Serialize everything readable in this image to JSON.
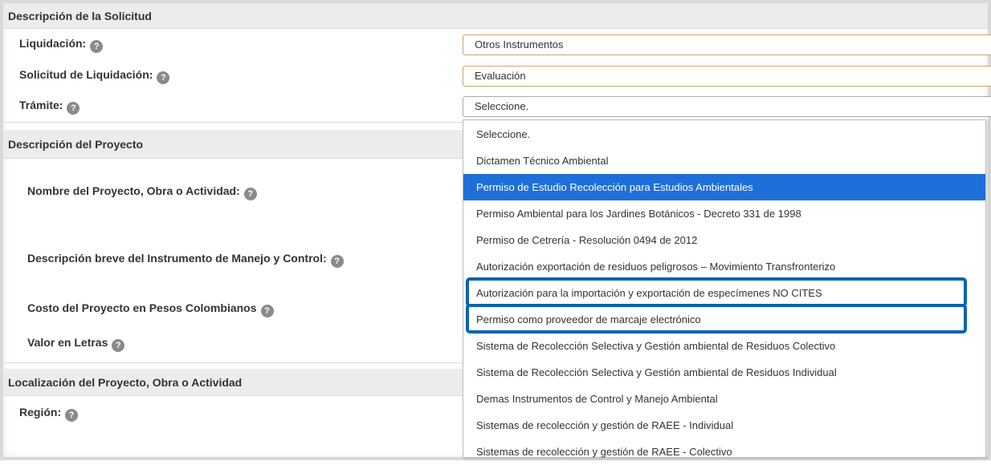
{
  "sections": {
    "solicitud": "Descripción de la Solicitud",
    "proyecto": "Descripción del Proyecto",
    "localizacion": "Localización del Proyecto, Obra o Actividad"
  },
  "fields": {
    "liquidacion": {
      "label": "Liquidación:",
      "value": "Otros Instrumentos"
    },
    "solicitud_liquidacion": {
      "label": "Solicitud de Liquidación:",
      "value": "Evaluación"
    },
    "tramite": {
      "label": "Trámite:",
      "value": "Seleccione."
    },
    "nombre_proyecto": {
      "label": "Nombre del Proyecto, Obra o Actividad:"
    },
    "descripcion_breve": {
      "label": "Descripción breve del Instrumento de Manejo y Control:"
    },
    "costo": {
      "label": "Costo del Proyecto en Pesos Colombianos"
    },
    "valor_letras": {
      "label": "Valor en Letras"
    },
    "region": {
      "label": "Región:"
    }
  },
  "help_glyph": "?",
  "dropdown": {
    "selected_index": 2,
    "highlighted_indices": [
      6,
      7
    ],
    "options": [
      "Seleccione.",
      "Dictamen Técnico Ambiental",
      "Permiso de Estudio Recolección para Estudios Ambientales",
      "Permiso Ambiental para los Jardines Botánicos - Decreto 331 de 1998",
      "Permiso de Cetrería - Resolución 0494 de 2012",
      "Autorización exportación de residuos peligrosos – Movimiento Transfronterizo",
      "Autorización para la importación y exportación de especímenes NO CITES",
      "Permiso como proveedor de marcaje electrónico",
      "Sistema de Recolección Selectiva y Gestión ambiental de Residuos Colectivo",
      "Sistema de Recolección Selectiva y Gestión ambiental de Residuos Individual",
      "Demas Instrumentos de Control y Manejo Ambiental",
      "Sistemas de recolección y gestión de RAEE - Individual",
      "Sistemas de recolección y gestión de RAEE - Colectivo"
    ]
  },
  "colors": {
    "selected_bg": "#1e6fd9",
    "highlight_border": "#0b63b3",
    "field_border": "#c9a86a"
  }
}
